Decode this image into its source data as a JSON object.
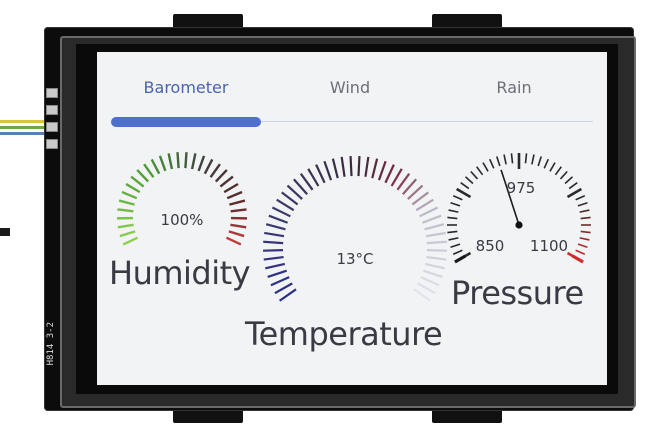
{
  "tabs": [
    {
      "label": "Barometer",
      "active": true
    },
    {
      "label": "Wind",
      "active": false
    },
    {
      "label": "Rain",
      "active": false
    }
  ],
  "accent_color": "#4f6fd0",
  "humidity": {
    "label": "Humidity",
    "value_text": "100%",
    "value": 100
  },
  "temperature": {
    "label": "Temperature",
    "value_text": "13°C",
    "value": 13
  },
  "pressure": {
    "label": "Pressure",
    "value": 975,
    "scale_min_label": "850",
    "scale_mid_label": "975",
    "scale_max_label": "1100",
    "min": 850,
    "max": 1100
  },
  "board_silkscreen": "H814 3-2"
}
